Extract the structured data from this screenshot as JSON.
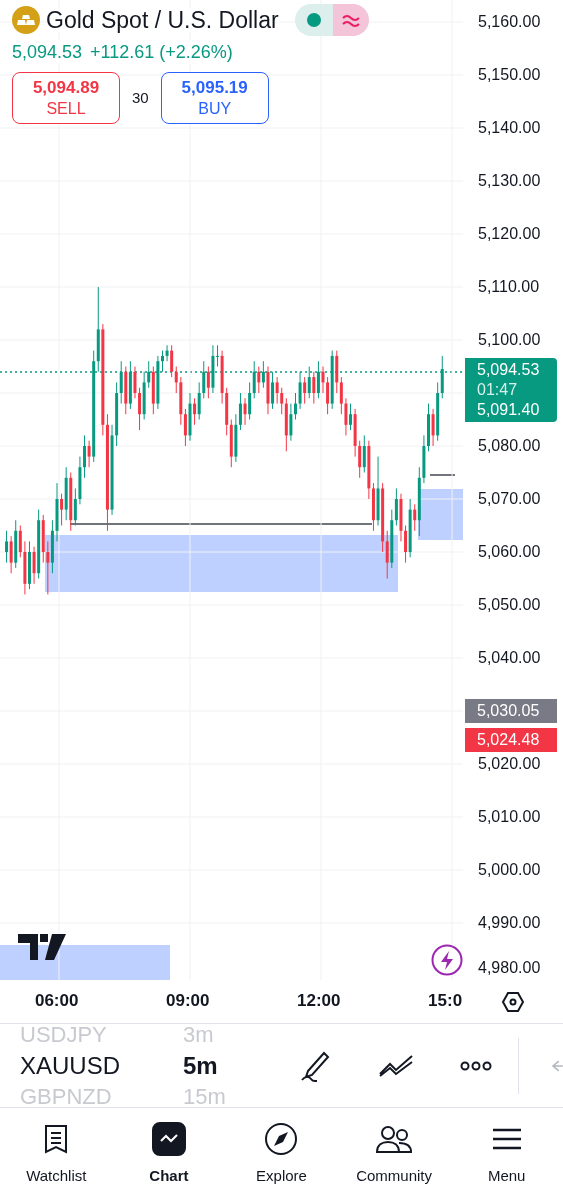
{
  "header": {
    "title": "Gold Spot / U.S. Dollar",
    "price": "5,094.53",
    "change": "+112.61 (+2.26%)"
  },
  "trade": {
    "sell": {
      "price": "5,094.89",
      "label": "SELL"
    },
    "spread": "30",
    "buy": {
      "price": "5,095.19",
      "label": "BUY"
    }
  },
  "last_price": {
    "price": "5,094.53",
    "countdown": "01:47",
    "secondary": "5,091.40"
  },
  "price_markers": [
    {
      "value": "5,030.05",
      "color": "#787b86"
    },
    {
      "value": "5,024.48",
      "color": "#f23645"
    }
  ],
  "chart_data": {
    "type": "candlestick",
    "xlim": [
      4.65,
      15.25
    ],
    "ylim": [
      4979.25,
      5164.15
    ],
    "grid": true,
    "xticks": [
      {
        "value": 6,
        "label": "06:00"
      },
      {
        "value": 9,
        "label": "09:00"
      },
      {
        "value": 12,
        "label": "12:00"
      },
      {
        "value": 15,
        "label": "15:0"
      }
    ],
    "yticks": [
      {
        "value": 5160,
        "label": "5,160.00"
      },
      {
        "value": 5150,
        "label": "5,150.00"
      },
      {
        "value": 5140,
        "label": "5,140.00"
      },
      {
        "value": 5130,
        "label": "5,130.00"
      },
      {
        "value": 5120,
        "label": "5,120.00"
      },
      {
        "value": 5110,
        "label": "5,110.00"
      },
      {
        "value": 5100,
        "label": "5,100.00"
      },
      {
        "value": 5080,
        "label": "5,080.00"
      },
      {
        "value": 5070,
        "label": "5,070.00"
      },
      {
        "value": 5060,
        "label": "5,060.00"
      },
      {
        "value": 5050,
        "label": "5,050.00"
      },
      {
        "value": 5040,
        "label": "5,040.00"
      },
      {
        "value": 5020,
        "label": "5,020.00"
      },
      {
        "value": 5010,
        "label": "5,010.00"
      },
      {
        "value": 5000,
        "label": "5,000.00"
      },
      {
        "value": 4990,
        "label": "4,990.00"
      },
      {
        "value": 4980,
        "label": "4,980.00"
      }
    ],
    "x": [
      4.8,
      4.905,
      5.01,
      5.115,
      5.22,
      5.325,
      5.43,
      5.535,
      5.64,
      5.745,
      5.85,
      5.955,
      6.06,
      6.165,
      6.27,
      6.375,
      6.48,
      6.585,
      6.69,
      6.795,
      6.9,
      7.005,
      7.11,
      7.215,
      7.32,
      7.425,
      7.53,
      7.635,
      7.74,
      7.845,
      7.95,
      8.055,
      8.16,
      8.265,
      8.37,
      8.475,
      8.58,
      8.685,
      8.79,
      8.895,
      9.0,
      9.105,
      9.21,
      9.315,
      9.42,
      9.525,
      9.63,
      9.735,
      9.84,
      9.945,
      10.05,
      10.155,
      10.26,
      10.365,
      10.47,
      10.575,
      10.68,
      10.785,
      10.89,
      10.995,
      11.1,
      11.205,
      11.31,
      11.415,
      11.52,
      11.625,
      11.73,
      11.835,
      11.94,
      12.045,
      12.15,
      12.255,
      12.36,
      12.465,
      12.57,
      12.675,
      12.78,
      12.885,
      12.99,
      13.095,
      13.2,
      13.305,
      13.41,
      13.515,
      13.62,
      13.725,
      13.83,
      13.935,
      14.04,
      14.145,
      14.25,
      14.355,
      14.46,
      14.565,
      14.67,
      14.775
    ],
    "ohlc": [
      [
        5060,
        5064,
        5058,
        5062
      ],
      [
        5062,
        5063,
        5056,
        5058
      ],
      [
        5058,
        5066,
        5057,
        5064
      ],
      [
        5064,
        5065,
        5059,
        5060
      ],
      [
        5060,
        5062,
        5052,
        5054
      ],
      [
        5054,
        5062,
        5053,
        5060
      ],
      [
        5060,
        5061,
        5054,
        5056
      ],
      [
        5056,
        5068,
        5055,
        5066
      ],
      [
        5066,
        5067,
        5058,
        5060
      ],
      [
        5060,
        5062,
        5052,
        5058
      ],
      [
        5058,
        5066,
        5056,
        5064
      ],
      [
        5064,
        5073,
        5062,
        5070
      ],
      [
        5070,
        5071,
        5065,
        5068
      ],
      [
        5068,
        5076,
        5066,
        5074
      ],
      [
        5074,
        5075,
        5064,
        5066
      ],
      [
        5066,
        5072,
        5065,
        5070
      ],
      [
        5070,
        5078,
        5069,
        5076
      ],
      [
        5076,
        5082,
        5074,
        5080
      ],
      [
        5080,
        5081,
        5076,
        5078
      ],
      [
        5078,
        5098,
        5077,
        5096
      ],
      [
        5096,
        5110,
        5094,
        5102
      ],
      [
        5102,
        5103,
        5082,
        5084
      ],
      [
        5084,
        5086,
        5064,
        5068
      ],
      [
        5068,
        5084,
        5067,
        5082
      ],
      [
        5082,
        5092,
        5080,
        5090
      ],
      [
        5090,
        5096,
        5088,
        5094
      ],
      [
        5094,
        5095,
        5086,
        5088
      ],
      [
        5088,
        5096,
        5087,
        5094
      ],
      [
        5094,
        5095,
        5089,
        5090
      ],
      [
        5090,
        5091,
        5083,
        5086
      ],
      [
        5086,
        5094,
        5085,
        5092
      ],
      [
        5092,
        5096,
        5091,
        5094
      ],
      [
        5094,
        5095,
        5086,
        5088
      ],
      [
        5088,
        5097,
        5087,
        5096
      ],
      [
        5096,
        5098,
        5094,
        5097
      ],
      [
        5097,
        5099,
        5096,
        5098
      ],
      [
        5098,
        5099,
        5093,
        5094
      ],
      [
        5094,
        5095,
        5090,
        5092
      ],
      [
        5092,
        5093,
        5084,
        5086
      ],
      [
        5086,
        5087,
        5080,
        5082
      ],
      [
        5082,
        5090,
        5081,
        5088
      ],
      [
        5088,
        5089,
        5084,
        5086
      ],
      [
        5086,
        5092,
        5085,
        5090
      ],
      [
        5090,
        5096,
        5089,
        5094
      ],
      [
        5094,
        5095,
        5089,
        5091
      ],
      [
        5091,
        5099,
        5090,
        5097
      ],
      [
        5097,
        5099,
        5095,
        5097
      ],
      [
        5097,
        5098,
        5088,
        5090
      ],
      [
        5090,
        5091,
        5082,
        5084
      ],
      [
        5084,
        5085,
        5076,
        5078
      ],
      [
        5078,
        5086,
        5077,
        5084
      ],
      [
        5084,
        5090,
        5083,
        5088
      ],
      [
        5088,
        5089,
        5084,
        5086
      ],
      [
        5086,
        5092,
        5085,
        5090
      ],
      [
        5090,
        5096,
        5089,
        5094
      ],
      [
        5094,
        5095,
        5090,
        5092
      ],
      [
        5092,
        5096,
        5091,
        5094
      ],
      [
        5094,
        5095,
        5086,
        5088
      ],
      [
        5088,
        5094,
        5087,
        5092
      ],
      [
        5092,
        5093,
        5088,
        5090
      ],
      [
        5090,
        5091,
        5086,
        5088
      ],
      [
        5088,
        5089,
        5079,
        5082
      ],
      [
        5082,
        5088,
        5081,
        5086
      ],
      [
        5086,
        5090,
        5085,
        5088
      ],
      [
        5088,
        5094,
        5087,
        5092
      ],
      [
        5092,
        5093,
        5088,
        5090
      ],
      [
        5090,
        5095,
        5089,
        5093
      ],
      [
        5093,
        5094,
        5088,
        5090
      ],
      [
        5090,
        5096,
        5089,
        5094
      ],
      [
        5094,
        5095,
        5090,
        5092
      ],
      [
        5092,
        5093,
        5086,
        5088
      ],
      [
        5088,
        5098,
        5087,
        5097
      ],
      [
        5097,
        5098,
        5090,
        5092
      ],
      [
        5092,
        5093,
        5086,
        5088
      ],
      [
        5088,
        5089,
        5082,
        5084
      ],
      [
        5084,
        5088,
        5083,
        5086
      ],
      [
        5086,
        5087,
        5078,
        5080
      ],
      [
        5080,
        5081,
        5074,
        5076
      ],
      [
        5076,
        5082,
        5075,
        5080
      ],
      [
        5080,
        5081,
        5070,
        5072
      ],
      [
        5072,
        5073,
        5064,
        5066
      ],
      [
        5066,
        5078,
        5065,
        5072
      ],
      [
        5072,
        5073,
        5060,
        5062
      ],
      [
        5062,
        5064,
        5055,
        5058
      ],
      [
        5058,
        5068,
        5057,
        5066
      ],
      [
        5066,
        5072,
        5065,
        5070
      ],
      [
        5070,
        5071,
        5062,
        5064
      ],
      [
        5064,
        5065,
        5058,
        5060
      ],
      [
        5060,
        5070,
        5059,
        5068
      ],
      [
        5068,
        5069,
        5064,
        5066
      ],
      [
        5066,
        5076,
        5063,
        5074
      ],
      [
        5074,
        5082,
        5073,
        5080
      ],
      [
        5080,
        5088,
        5079,
        5086
      ],
      [
        5086,
        5087,
        5080,
        5082
      ],
      [
        5082,
        5092,
        5081,
        5090
      ],
      [
        5090,
        5097,
        5089,
        5094.53
      ]
    ]
  },
  "symbols": [
    {
      "symbol": "USDJPY",
      "interval": "3m",
      "selected": false
    },
    {
      "symbol": "XAUUSD",
      "interval": "5m",
      "selected": true
    },
    {
      "symbol": "GBPNZD",
      "interval": "15m",
      "selected": false
    }
  ],
  "nav": [
    {
      "label": "Watchlist",
      "selected": false
    },
    {
      "label": "Chart",
      "selected": true
    },
    {
      "label": "Explore",
      "selected": false
    },
    {
      "label": "Community",
      "selected": false
    },
    {
      "label": "Menu",
      "selected": false
    }
  ]
}
